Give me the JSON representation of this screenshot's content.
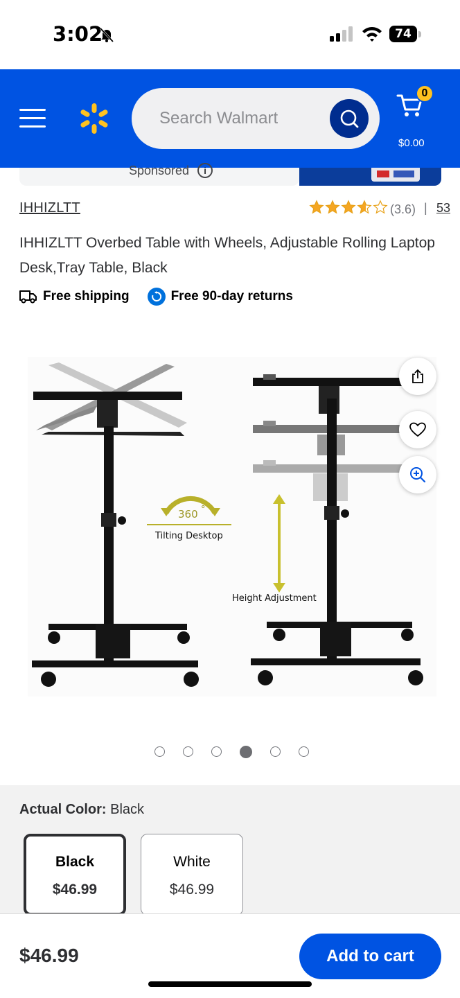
{
  "status_bar": {
    "time": "3:02",
    "battery": "74"
  },
  "header": {
    "search_placeholder": "Search Walmart",
    "cart_count": "0",
    "cart_total": "$0.00",
    "brand_color": "#0053e2",
    "spark_color": "#ffc220"
  },
  "sponsored": {
    "label": "Sponsored",
    "info_icon": "info-icon"
  },
  "product": {
    "seller": "IHHIZLTT",
    "rating_text": "(3.6)",
    "rating_value": 3.6,
    "rating_max": 5,
    "review_count": "53",
    "title": "IHHIZLTT Overbed Table with Wheels, Adjustable Rolling Laptop Desk,Tray Table, Black",
    "badges": {
      "shipping": "Free shipping",
      "returns": "Free 90-day returns"
    },
    "image_annotations": {
      "rotation": "360",
      "rotation_unit": "°",
      "tilt_label": "Tilting Desktop",
      "height_label": "Height Adjustment"
    },
    "carousel": {
      "total": 6,
      "active_index": 3
    }
  },
  "variants": {
    "label": "Actual Color:",
    "selected_value": "Black",
    "options": [
      {
        "name": "Black",
        "price": "$46.99"
      },
      {
        "name": "White",
        "price": "$46.99"
      }
    ]
  },
  "bottom_bar": {
    "price": "$46.99",
    "add_to_cart_label": "Add to cart"
  }
}
